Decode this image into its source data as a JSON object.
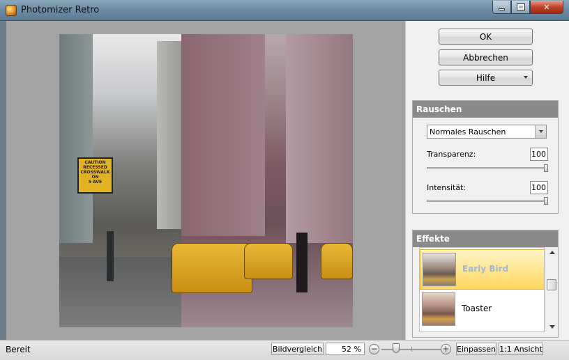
{
  "window": {
    "title": "Photomizer Retro",
    "minimize_icon": "minimize-icon",
    "maximize_icon": "maximize-icon",
    "close_icon": "close-icon",
    "close_glyph": "✕"
  },
  "photo": {
    "sign_lines": [
      "CAUTION",
      "RECESSED",
      "CROSSWALK",
      "ON",
      "5 AVE"
    ]
  },
  "buttons": {
    "ok": "OK",
    "cancel": "Abbrechen",
    "help": "Hilfe"
  },
  "rauschen": {
    "title": "Rauschen",
    "select_value": "Normales Rauschen",
    "transparency_label": "Transparenz:",
    "transparency_value": "100",
    "transparency_fraction": 1.0,
    "intensity_label": "Intensität:",
    "intensity_value": "100",
    "intensity_fraction": 1.0
  },
  "effekte": {
    "title": "Effekte",
    "items": [
      {
        "name": "Early Bird",
        "selected": true
      },
      {
        "name": "Toaster",
        "selected": false
      }
    ]
  },
  "statusbar": {
    "status": "Bereit",
    "compare": "Bildvergleich",
    "zoom": "52 %",
    "zoom_minus": "−",
    "zoom_plus": "+",
    "fit": "Einpassen",
    "actual": "1:1 Ansicht"
  },
  "colors": {
    "accent_selected": "#ffd75e",
    "group_header": "#8a8a8a",
    "workspace": "#a3a3a3"
  }
}
